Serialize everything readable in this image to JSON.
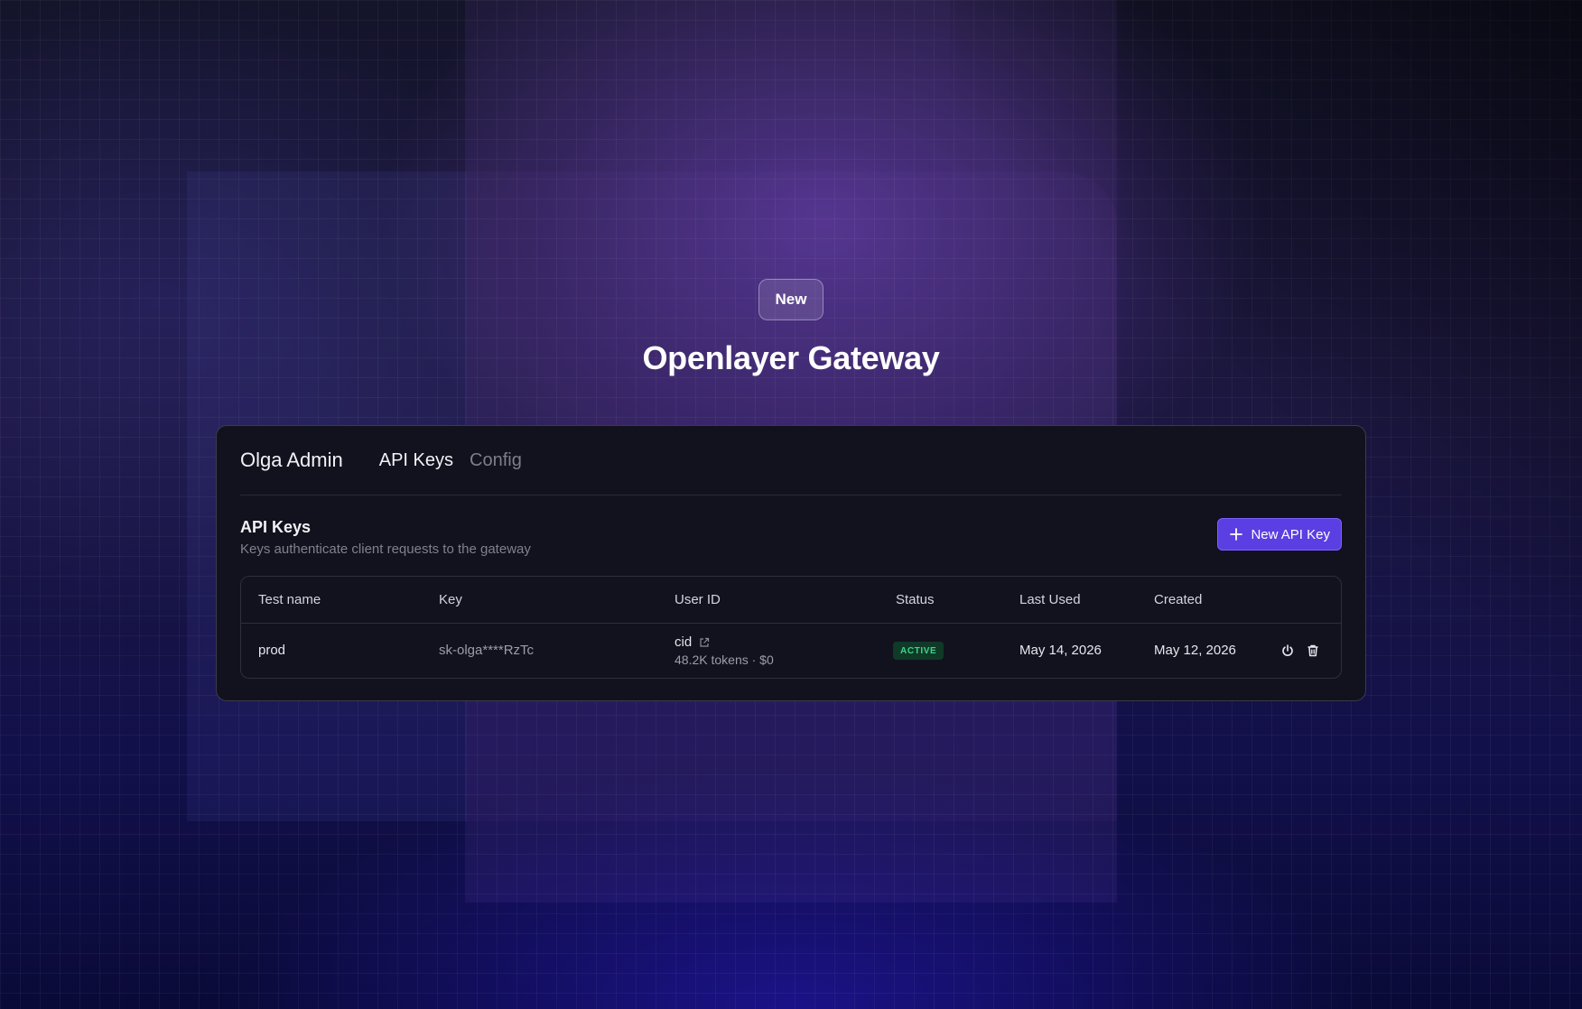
{
  "hero": {
    "badge": "New",
    "title": "Openlayer Gateway"
  },
  "header": {
    "org_name": "Olga Admin",
    "tabs": [
      {
        "label": "API Keys",
        "active": true
      },
      {
        "label": "Config",
        "active": false
      }
    ]
  },
  "section": {
    "title": "API Keys",
    "subtitle": "Keys authenticate client requests to the gateway",
    "new_button_label": "New API Key",
    "new_button_icon": "plus-icon"
  },
  "table": {
    "columns": [
      "Test name",
      "Key",
      "User ID",
      "Status",
      "Last Used",
      "Created"
    ],
    "rows": [
      {
        "name": "prod",
        "key": "sk-olga****RzTc",
        "user_id": "cid",
        "user_id_icon": "external-link-icon",
        "usage": "48.2K tokens · $0",
        "status": "ACTIVE",
        "last_used": "May 14, 2026",
        "created": "May 12, 2026",
        "actions": [
          "power-icon",
          "trash-icon"
        ]
      }
    ]
  },
  "colors": {
    "accent": "#5b3fe3",
    "status_active_bg": "#0f3a28",
    "status_active_text": "#3fd38a",
    "card_bg": "#12121e"
  }
}
